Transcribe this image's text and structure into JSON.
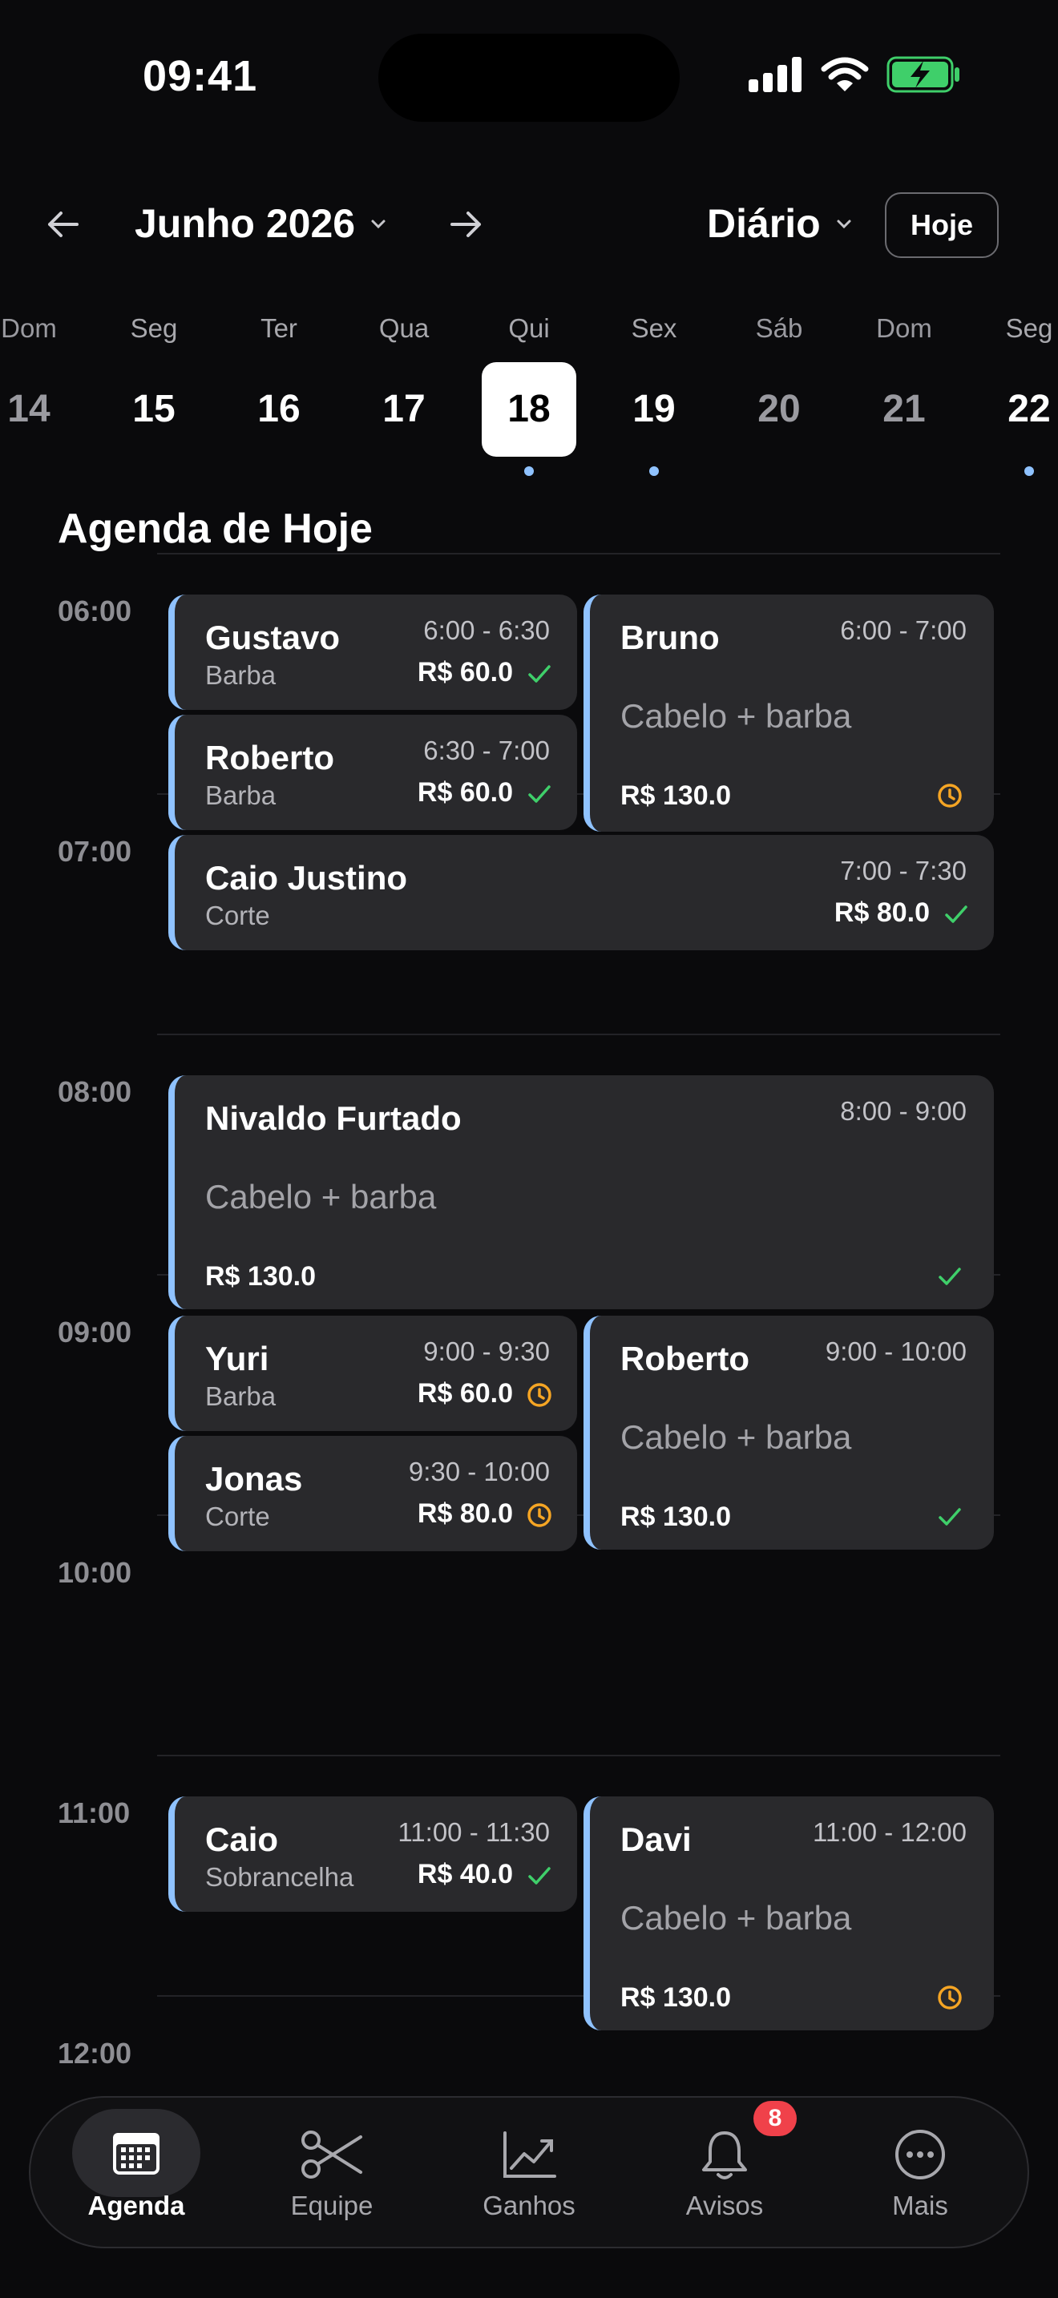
{
  "status_bar": {
    "time": "09:41"
  },
  "header": {
    "month": "Junho 2026",
    "view": "Diário",
    "today_label": "Hoje"
  },
  "week": [
    {
      "name": "Dom",
      "num": "14",
      "weekend": true,
      "dot": false
    },
    {
      "name": "Seg",
      "num": "15",
      "weekend": false,
      "dot": false
    },
    {
      "name": "Ter",
      "num": "16",
      "weekend": false,
      "dot": false
    },
    {
      "name": "Qua",
      "num": "17",
      "weekend": false,
      "dot": false
    },
    {
      "name": "Qui",
      "num": "18",
      "weekend": false,
      "dot": true,
      "selected": true
    },
    {
      "name": "Sex",
      "num": "19",
      "weekend": false,
      "dot": true
    },
    {
      "name": "Sáb",
      "num": "20",
      "weekend": true,
      "dot": false
    },
    {
      "name": "Dom",
      "num": "21",
      "weekend": true,
      "dot": false
    },
    {
      "name": "Seg",
      "num": "22",
      "weekend": false,
      "dot": true
    }
  ],
  "agenda": {
    "title": "Agenda de Hoje",
    "hours": [
      "06:00",
      "07:00",
      "08:00",
      "09:00",
      "10:00",
      "11:00",
      "12:00"
    ],
    "appointments": [
      {
        "name": "Gustavo",
        "service": "Barba",
        "time": "6:00 - 6:30",
        "price": "R$ 60.0",
        "status": "done"
      },
      {
        "name": "Roberto",
        "service": "Barba",
        "time": "6:30 - 7:00",
        "price": "R$ 60.0",
        "status": "done"
      },
      {
        "name": "Bruno",
        "service": "Cabelo + barba",
        "time": "6:00 - 7:00",
        "price": "R$ 130.0",
        "status": "pending"
      },
      {
        "name": "Caio Justino",
        "service": "Corte",
        "time": "7:00 - 7:30",
        "price": "R$ 80.0",
        "status": "done"
      },
      {
        "name": "Nivaldo Furtado",
        "service": "Cabelo + barba",
        "time": "8:00 - 9:00",
        "price": "R$ 130.0",
        "status": "done"
      },
      {
        "name": "Yuri",
        "service": "Barba",
        "time": "9:00 - 9:30",
        "price": "R$ 60.0",
        "status": "pending"
      },
      {
        "name": "Jonas",
        "service": "Corte",
        "time": "9:30 - 10:00",
        "price": "R$ 80.0",
        "status": "pending"
      },
      {
        "name": "Roberto",
        "service": "Cabelo + barba",
        "time": "9:00 - 10:00",
        "price": "R$ 130.0",
        "status": "done"
      },
      {
        "name": "Caio",
        "service": "Sobrancelha",
        "time": "11:00 - 11:30",
        "price": "R$ 40.0",
        "status": "done"
      },
      {
        "name": "Davi",
        "service": "Cabelo + barba",
        "time": "11:00 - 12:00",
        "price": "R$ 130.0",
        "status": "pending"
      }
    ]
  },
  "tabbar": {
    "items": [
      {
        "label": "Agenda",
        "icon": "calendar-icon",
        "active": true
      },
      {
        "label": "Equipe",
        "icon": "scissors-icon"
      },
      {
        "label": "Ganhos",
        "icon": "chart-icon"
      },
      {
        "label": "Avisos",
        "icon": "bell-icon",
        "badge": "8"
      },
      {
        "label": "Mais",
        "icon": "more-icon"
      }
    ]
  },
  "colors": {
    "accent": "#8fc2ff",
    "done": "#3fcf6a",
    "pending": "#f5a524",
    "badge": "#f0414a"
  }
}
